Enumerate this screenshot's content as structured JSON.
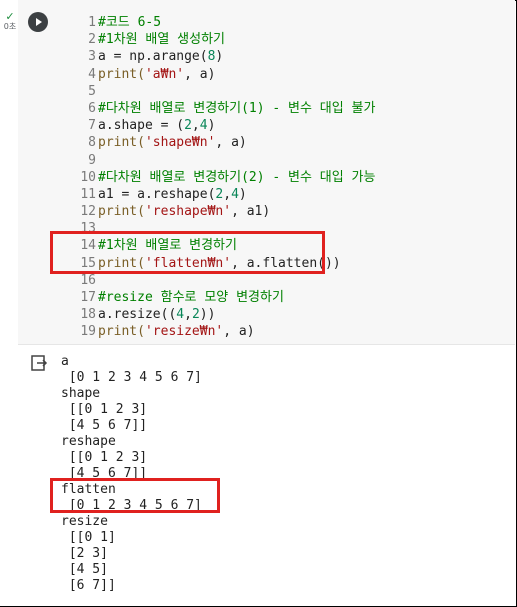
{
  "status": {
    "check": "✓",
    "duration": "0초"
  },
  "code_lines": [
    {
      "n": "1",
      "segments": [
        {
          "t": "#코드 6-5",
          "c": "cmt"
        }
      ]
    },
    {
      "n": "2",
      "segments": [
        {
          "t": "#1차원 배열 생성하기",
          "c": "cmt"
        }
      ]
    },
    {
      "n": "3",
      "segments": [
        {
          "t": "a = np.arange(",
          "c": ""
        },
        {
          "t": "8",
          "c": "num"
        },
        {
          "t": ")",
          "c": ""
        }
      ]
    },
    {
      "n": "4",
      "segments": [
        {
          "t": "print(",
          "c": "fn"
        },
        {
          "t": "'a₩n'",
          "c": "str"
        },
        {
          "t": ", a)",
          "c": ""
        }
      ]
    },
    {
      "n": "5",
      "segments": []
    },
    {
      "n": "6",
      "segments": [
        {
          "t": "#다차원 배열로 변경하기(1) - 변수 대입 불가",
          "c": "cmt"
        }
      ]
    },
    {
      "n": "7",
      "segments": [
        {
          "t": "a.shape = (",
          "c": ""
        },
        {
          "t": "2",
          "c": "num"
        },
        {
          "t": ",",
          "c": ""
        },
        {
          "t": "4",
          "c": "num"
        },
        {
          "t": ")",
          "c": ""
        }
      ]
    },
    {
      "n": "8",
      "segments": [
        {
          "t": "print(",
          "c": "fn"
        },
        {
          "t": "'shape₩n'",
          "c": "str"
        },
        {
          "t": ", a)",
          "c": ""
        }
      ]
    },
    {
      "n": "9",
      "segments": []
    },
    {
      "n": "10",
      "segments": [
        {
          "t": "#다차원 배열로 변경하기(2) - 변수 대입 가능",
          "c": "cmt"
        }
      ]
    },
    {
      "n": "11",
      "segments": [
        {
          "t": "a1 = a.reshape(",
          "c": ""
        },
        {
          "t": "2",
          "c": "num"
        },
        {
          "t": ",",
          "c": ""
        },
        {
          "t": "4",
          "c": "num"
        },
        {
          "t": ")",
          "c": ""
        }
      ]
    },
    {
      "n": "12",
      "segments": [
        {
          "t": "print(",
          "c": "fn"
        },
        {
          "t": "'reshape₩n'",
          "c": "str"
        },
        {
          "t": ", a1)",
          "c": ""
        }
      ]
    },
    {
      "n": "13",
      "segments": []
    },
    {
      "n": "14",
      "segments": [
        {
          "t": "#1차원 배열로 변경하기",
          "c": "cmt"
        }
      ]
    },
    {
      "n": "15",
      "segments": [
        {
          "t": "print(",
          "c": "fn"
        },
        {
          "t": "'flatten₩n'",
          "c": "str"
        },
        {
          "t": ", a.flatten())",
          "c": ""
        }
      ]
    },
    {
      "n": "16",
      "segments": []
    },
    {
      "n": "17",
      "segments": [
        {
          "t": "#resize 함수로 모양 변경하기",
          "c": "cmt"
        }
      ]
    },
    {
      "n": "18",
      "segments": [
        {
          "t": "a.resize((",
          "c": ""
        },
        {
          "t": "4",
          "c": "num"
        },
        {
          "t": ",",
          "c": ""
        },
        {
          "t": "2",
          "c": "num"
        },
        {
          "t": "))",
          "c": ""
        }
      ]
    },
    {
      "n": "19",
      "segments": [
        {
          "t": "print(",
          "c": "fn"
        },
        {
          "t": "'resize₩n'",
          "c": "str"
        },
        {
          "t": ", a)",
          "c": ""
        }
      ]
    }
  ],
  "output": {
    "text": "a\n [0 1 2 3 4 5 6 7]\nshape\n [[0 1 2 3]\n [4 5 6 7]]\nreshape\n [[0 1 2 3]\n [4 5 6 7]]\nflatten\n [0 1 2 3 4 5 6 7]\nresize\n [[0 1]\n [2 3]\n [4 5]\n [6 7]]"
  },
  "colors": {
    "highlight": "#e0211f",
    "comment": "#008000",
    "string": "#a31515"
  }
}
